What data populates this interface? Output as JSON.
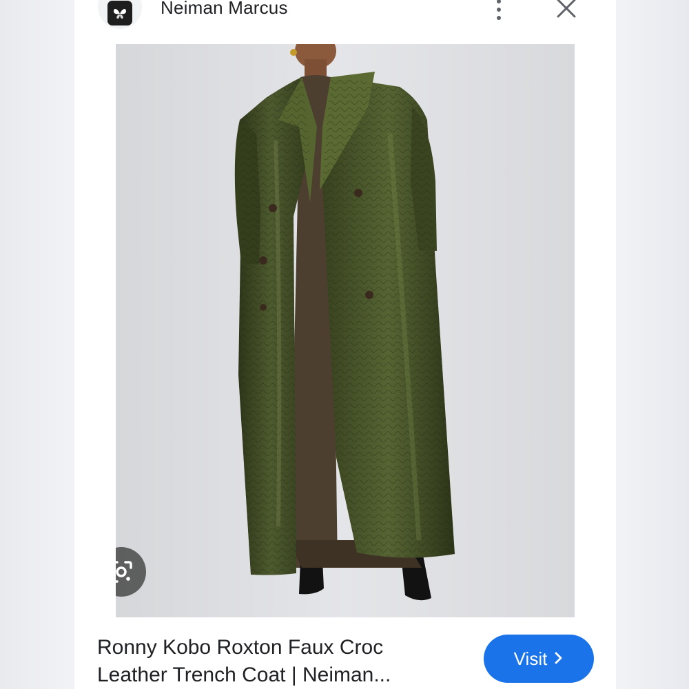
{
  "header": {
    "site_name": "Neiman Marcus",
    "favicon_icon": "butterfly-icon",
    "more_icon": "more-vert-icon",
    "close_icon": "close-icon"
  },
  "image": {
    "alt": "Ronny Kobo Roxton Faux Croc Leather Trench Coat",
    "lens_icon": "google-lens-icon"
  },
  "result": {
    "title_line1": "Ronny Kobo Roxton Faux Croc",
    "title_line2": "Leather Trench Coat | Neiman...",
    "visit_label": "Visit",
    "visit_icon": "chevron-right-icon"
  },
  "colors": {
    "accent": "#1a73e8",
    "coat": "#3f4a26",
    "background": "#dfe0e3"
  }
}
